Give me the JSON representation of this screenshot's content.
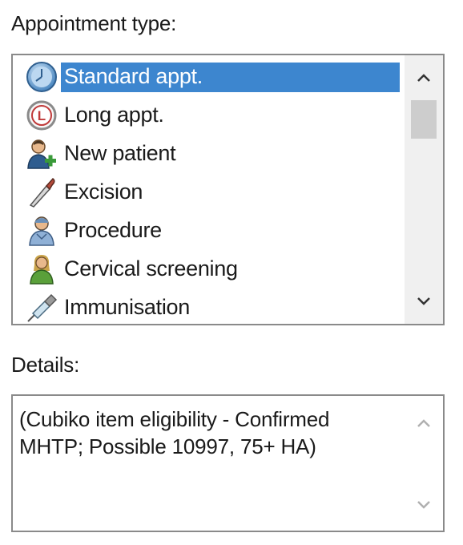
{
  "appointment_type": {
    "label": "Appointment type:",
    "items": [
      {
        "label": "Standard appt.",
        "icon": "clock-icon",
        "selected": true
      },
      {
        "label": "Long appt.",
        "icon": "long-clock-icon",
        "selected": false
      },
      {
        "label": "New patient",
        "icon": "new-patient-icon",
        "selected": false
      },
      {
        "label": "Excision",
        "icon": "scalpel-icon",
        "selected": false
      },
      {
        "label": "Procedure",
        "icon": "procedure-person-icon",
        "selected": false
      },
      {
        "label": "Cervical screening",
        "icon": "cervical-screening-icon",
        "selected": false
      },
      {
        "label": "Immunisation",
        "icon": "syringe-icon",
        "selected": false
      }
    ]
  },
  "details": {
    "label": "Details:",
    "value": "(Cubiko item eligibility - Confirmed MHTP; Possible 10997, 75+ HA)"
  },
  "colors": {
    "selection": "#3d86cf",
    "border": "#8a8a8a",
    "scrollbar_track": "#f0f0f0",
    "scrollbar_thumb": "#cdcdcd"
  }
}
